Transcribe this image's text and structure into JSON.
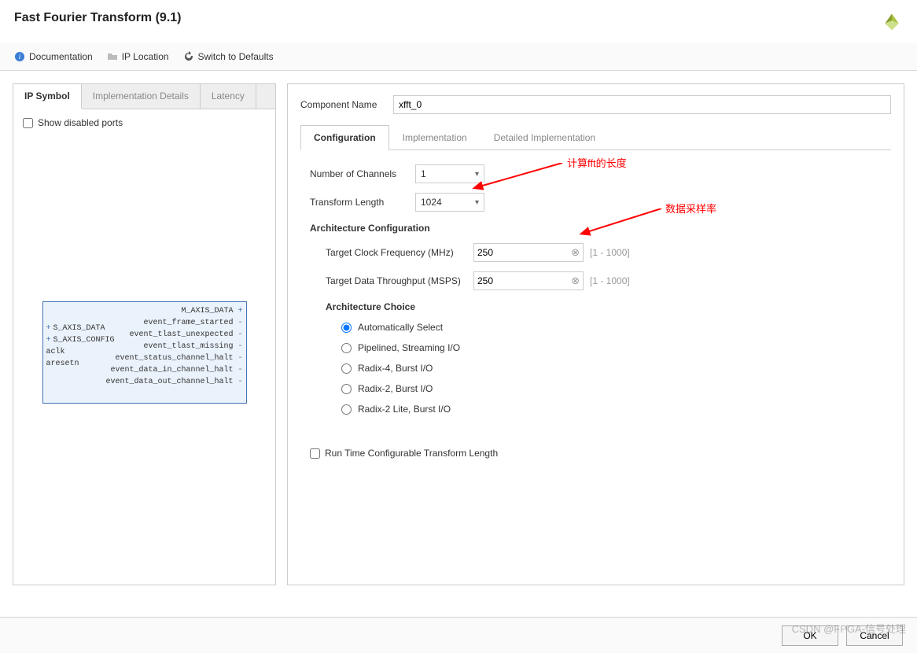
{
  "header": {
    "title": "Fast Fourier Transform (9.1)"
  },
  "toolbar": {
    "documentation": "Documentation",
    "ip_location": "IP Location",
    "switch_defaults": "Switch to Defaults"
  },
  "left": {
    "tabs": [
      "IP Symbol",
      "Implementation Details",
      "Latency"
    ],
    "show_disabled": "Show disabled ports",
    "ip_left_ports": [
      "S_AXIS_DATA",
      "S_AXIS_CONFIG"
    ],
    "ip_left_plain": [
      "aclk",
      "aresetn"
    ],
    "ip_right_ports": [
      "M_AXIS_DATA"
    ],
    "ip_right_events": [
      "event_frame_started",
      "event_tlast_unexpected",
      "event_tlast_missing",
      "event_status_channel_halt",
      "event_data_in_channel_halt",
      "event_data_out_channel_halt"
    ]
  },
  "right": {
    "component_name_label": "Component Name",
    "component_name_value": "xfft_0",
    "tabs": [
      "Configuration",
      "Implementation",
      "Detailed Implementation"
    ],
    "num_channels_label": "Number of Channels",
    "num_channels_value": "1",
    "transform_length_label": "Transform Length",
    "transform_length_value": "1024",
    "arch_config_header": "Architecture Configuration",
    "target_clock_label": "Target Clock Frequency (MHz)",
    "target_clock_value": "250",
    "target_clock_range": "[1 - 1000]",
    "target_throughput_label": "Target Data Throughput (MSPS)",
    "target_throughput_value": "250",
    "target_throughput_range": "[1 - 1000]",
    "arch_choice_header": "Architecture Choice",
    "arch_options": [
      "Automatically Select",
      "Pipelined, Streaming I/O",
      "Radix-4, Burst I/O",
      "Radix-2, Burst I/O",
      "Radix-2 Lite, Burst I/O"
    ],
    "runtime_checkbox": "Run Time Configurable Transform Length"
  },
  "annotations": {
    "fft_length": "计算fft的长度",
    "sample_rate": "数据采样率"
  },
  "footer": {
    "ok": "OK",
    "cancel": "Cancel"
  },
  "watermark": "CSDN @FPGA-信号处理"
}
